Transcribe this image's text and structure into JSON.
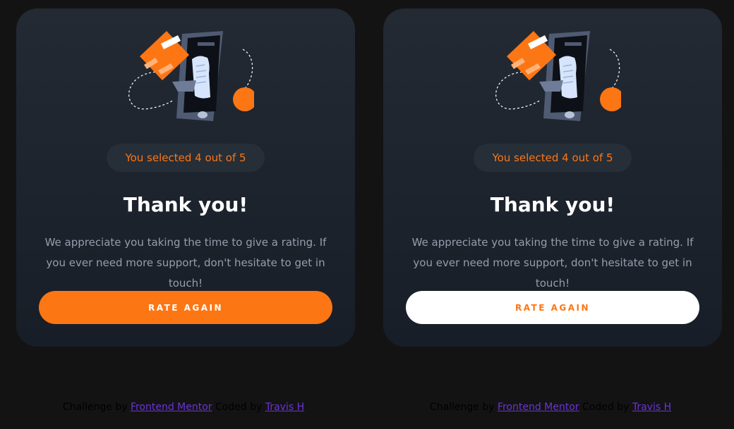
{
  "cards": [
    {
      "selection_text": "You selected 4 out of 5",
      "title": "Thank you!",
      "message": "We appreciate you taking the time to give a rating. If you ever need more support, don't hesitate to get in touch!",
      "button_label": "RATE AGAIN",
      "button_state": "default"
    },
    {
      "selection_text": "You selected 4 out of 5",
      "title": "Thank you!",
      "message": "We appreciate you taking the time to give a rating. If you ever need more support, don't hesitate to get in touch!",
      "button_label": "RATE AGAIN",
      "button_state": "hover"
    }
  ],
  "footer": {
    "challenge_prefix": "Challenge by",
    "challenge_link": "Frontend Mentor",
    "coded_prefix": "Coded by",
    "author_link": "Travis H"
  },
  "colors": {
    "accent": "#fc7614",
    "background": "#131313",
    "card_top": "#232a34",
    "card_bottom": "#181e27",
    "pill_bg": "#262e38",
    "text_muted": "#959eac",
    "link": "#6934d6"
  },
  "icons": {
    "illustration": "thank-you-illustration"
  }
}
